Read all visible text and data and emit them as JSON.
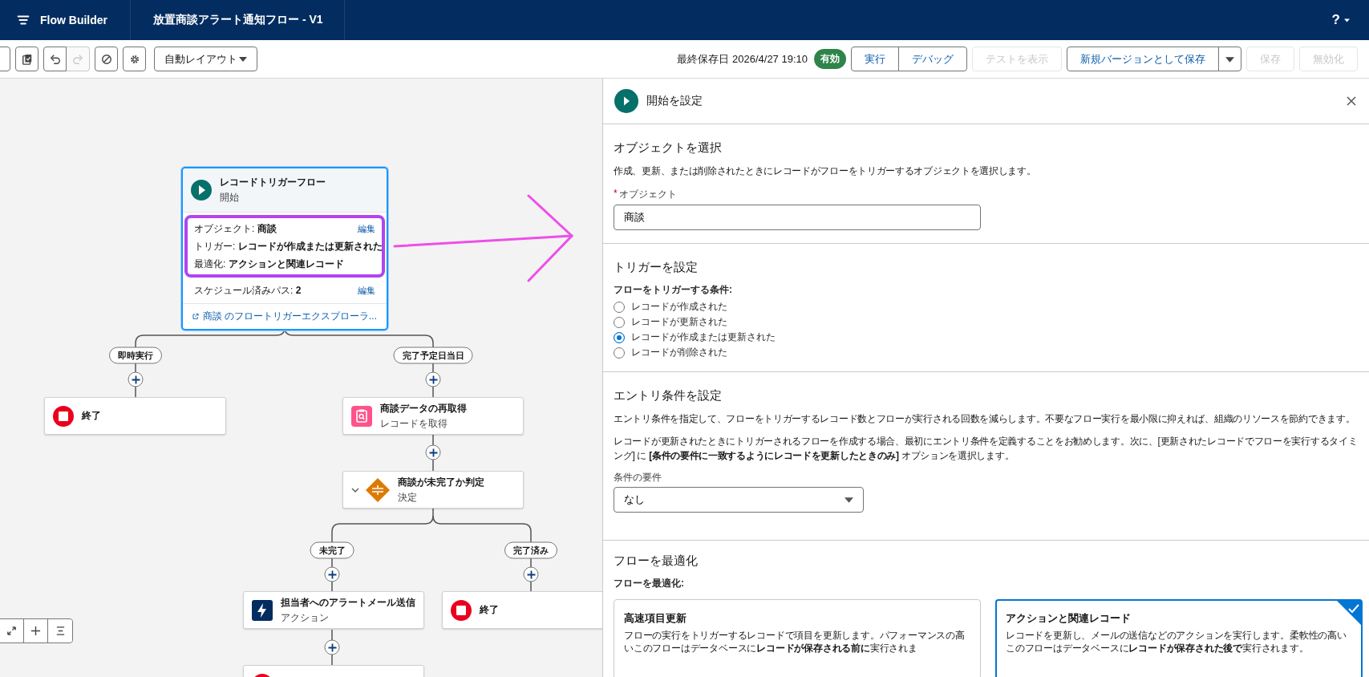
{
  "app_bar": {
    "app_name": "Flow Builder",
    "flow_title": "放置商談アラート通知フロー - V1",
    "help": "?"
  },
  "toolbar": {
    "icon_buttons": [
      {
        "kind": "partial",
        "disabled": false
      },
      {
        "kind": "copy",
        "disabled": false
      },
      {
        "kind": "undo",
        "disabled": false
      },
      {
        "kind": "redo",
        "disabled": true
      },
      {
        "kind": "blocked",
        "disabled": false
      },
      {
        "kind": "settings",
        "disabled": false
      }
    ],
    "layout_menu": "自動レイアウト",
    "last_saved": "最終保存日 2026/4/27 19:10",
    "status_badge": "有効",
    "button_groups": [
      [
        {
          "label": "実行",
          "disabled": false,
          "has_menu": false
        },
        {
          "label": "デバッグ",
          "disabled": false,
          "has_menu": false
        }
      ],
      [
        {
          "label": "テストを表示",
          "disabled": true,
          "has_menu": false
        }
      ],
      [
        {
          "label": "新規バージョンとして保存",
          "disabled": false,
          "has_menu": true
        }
      ],
      [
        {
          "label": "保存",
          "disabled": true,
          "has_menu": false
        }
      ],
      [
        {
          "label": "無効化",
          "disabled": true,
          "has_menu": false
        }
      ]
    ]
  },
  "canvas": {
    "start_node": {
      "title": "レコードトリガーフロー",
      "subtitle": "開始",
      "details": [
        {
          "label": "オブジェクト:",
          "value": "商談",
          "action": "編集"
        },
        {
          "label": "トリガー:",
          "value": "レコードが作成または更新された"
        },
        {
          "label": "最適化:",
          "value": "アクションと関連レコード"
        }
      ],
      "scheduled": {
        "label": "スケジュール済みパス:",
        "value": "2",
        "action": "編集"
      },
      "explorer_link": "商談 のフロートリガーエクスプローラ..."
    },
    "branches": [
      {
        "label": "即時実行"
      },
      {
        "label": "完了予定日当日"
      },
      {
        "label": "未完了"
      },
      {
        "label": "完了済み"
      }
    ],
    "nodes": [
      {
        "kind": "end",
        "title": "終了"
      },
      {
        "kind": "get_records",
        "title": "商談データの再取得",
        "subtitle": "レコードを取得"
      },
      {
        "kind": "decision",
        "title": "商談が未完了か判定",
        "subtitle": "決定"
      },
      {
        "kind": "action",
        "title": "担当者へのアラートメール送信",
        "subtitle": "アクション"
      },
      {
        "kind": "end",
        "title": "終了"
      },
      {
        "kind": "end"
      }
    ],
    "annotations": {
      "highlight": true,
      "arrow": true
    }
  },
  "panel": {
    "title": "開始を設定",
    "object_section": {
      "heading": "オブジェクトを選択",
      "description": "作成、更新、または削除されたときにレコードがフローをトリガーするオブジェクトを選択します。",
      "field_label": "オブジェクト",
      "required_mark": "*",
      "value": "商談"
    },
    "trigger_section": {
      "heading": "トリガーを設定",
      "question": "フローをトリガーする条件:",
      "options": [
        {
          "label": "レコードが作成された",
          "selected": false
        },
        {
          "label": "レコードが更新された",
          "selected": false
        },
        {
          "label": "レコードが作成または更新された",
          "selected": true
        },
        {
          "label": "レコードが削除された",
          "selected": false
        }
      ]
    },
    "entry_section": {
      "heading": "エントリ条件を設定",
      "paragraphs": [
        "エントリ条件を指定して、フローをトリガーするレコード数とフローが実行される回数を減らします。不要なフロー実行を最小限に抑えれば、組織のリソースを節約できます。",
        "レコードが更新されたときにトリガーされるフローを作成する場合、最初にエントリ条件を定義することをお勧めします。次に、[更新されたレコードでフローを実行するタイミング] に **[条件の要件に一致するようにレコードを更新したときのみ]** オプションを選択します。"
      ],
      "select_label": "条件の要件",
      "select_value": "なし"
    },
    "optimize_section": {
      "heading": "フローを最適化",
      "question": "フローを最適化:",
      "cards": [
        {
          "title": "高速項目更新",
          "description": "フローの実行をトリガーするレコードで項目を更新します。パフォーマンスの高いこのフローはデータベースに**レコードが保存される前に**実行されま",
          "selected": false
        },
        {
          "title": "アクションと関連レコード",
          "description": "レコードを更新し、メールの送信などのアクションを実行します。柔軟性の高いこのフローはデータベースに**レコードが保存された後で**実行されます。",
          "selected": true
        }
      ]
    }
  }
}
